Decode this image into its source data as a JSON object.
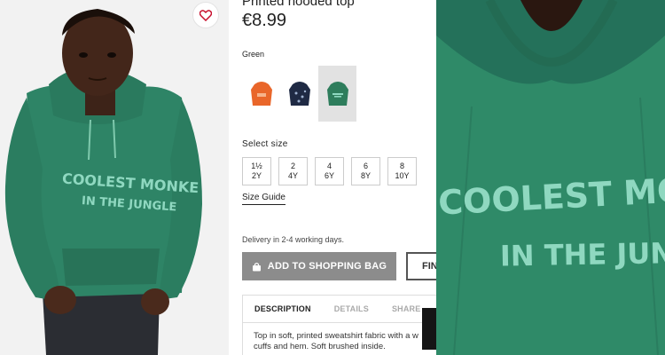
{
  "product": {
    "title": "Printed hooded top",
    "price": "€8.99",
    "color_label": "Green",
    "swatches": [
      {
        "name": "orange",
        "color": "#e9662a",
        "selected": false
      },
      {
        "name": "navy",
        "color": "#1f2a44",
        "selected": false
      },
      {
        "name": "green",
        "color": "#2e7d5c",
        "selected": true
      }
    ],
    "size_label": "Select size",
    "sizes": [
      {
        "top": "1½",
        "bottom": "2Y"
      },
      {
        "top": "2",
        "bottom": "4Y"
      },
      {
        "top": "4",
        "bottom": "6Y"
      },
      {
        "top": "6",
        "bottom": "8Y"
      },
      {
        "top": "8",
        "bottom": "10Y"
      }
    ],
    "size_guide": "Size Guide",
    "delivery": "Delivery in 2-4 working days.",
    "add_to_bag": "ADD TO SHOPPING BAG",
    "store_button": "FIN",
    "tabs": [
      "DESCRIPTION",
      "DETAILS",
      "SHARE"
    ],
    "description": [
      "Top in soft, printed sweatshirt fabric with a w",
      "cuffs and hem. Soft brushed inside."
    ]
  },
  "hoodie_print": {
    "line1": "COOLEST MONKE",
    "line2": "IN THE JUNGLE",
    "closeup_line1": "COOLEST MON",
    "closeup_line2": "IN THE JUNG"
  },
  "icons": {
    "wishlist": "heart-icon",
    "bag": "shopping-bag-icon"
  },
  "colors": {
    "hoodie": "#2f8a68",
    "print": "#8fd8c0",
    "button": "#8c8c8c",
    "wishlist_heart": "#c8102e"
  }
}
